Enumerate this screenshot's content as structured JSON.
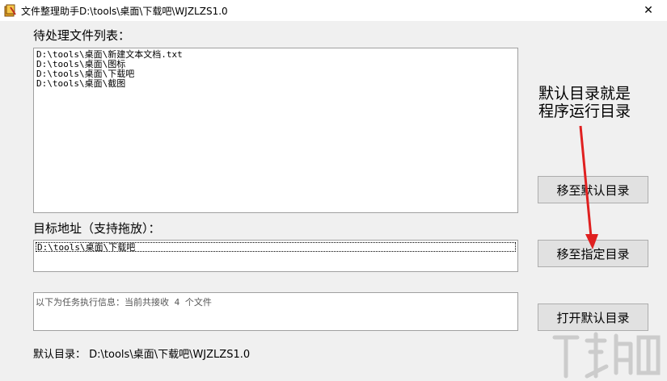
{
  "window": {
    "title": "文件整理助手D:\\tools\\桌面\\下载吧\\WJZLZS1.0",
    "close_glyph": "✕"
  },
  "pending": {
    "label": "待处理文件列表：",
    "items": [
      "D:\\tools\\桌面\\新建文本文档.txt",
      "D:\\tools\\桌面\\图标",
      "D:\\tools\\桌面\\下载吧",
      "D:\\tools\\桌面\\截图"
    ]
  },
  "target": {
    "label": "目标地址（支持拖放）：",
    "value": "D:\\tools\\桌面\\下载吧"
  },
  "info": {
    "text": "以下为任务执行信息：当前共接收 4 个文件"
  },
  "footer": {
    "default_dir_label": "默认目录：",
    "default_dir_value": "D:\\tools\\桌面\\下载吧\\WJZLZS1.0"
  },
  "buttons": {
    "move_default": "移至默认目录",
    "move_specified": "移至指定目录",
    "open_default": "打开默认目录"
  },
  "annotation": {
    "line1": "默认目录就是",
    "line2": "程序运行目录",
    "arrow_color": "#e02020"
  },
  "icons": {
    "app": "app-icon",
    "close": "close-icon"
  }
}
